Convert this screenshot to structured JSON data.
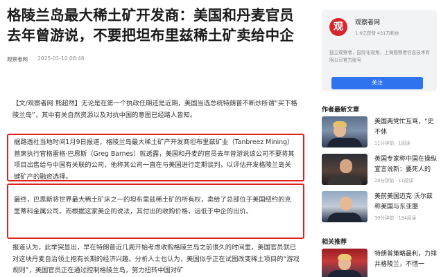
{
  "article": {
    "title": "格陵兰岛最大稀土矿开发商：美国和丹麦官员去年曾游说，不要把坦布里兹稀土矿卖给中企",
    "source": "观察者网",
    "date": "2025-01-10 08:46",
    "p1_tag": "【文/观察者网 熊超然】",
    "p1": "无论是在第一个执政任期还是近期，美国当选总统特朗普不断炒所谓“买下格陵兰岛”，其中有关自然资源以及对抗中国的意图已经路人皆知。",
    "p2": "据路透社当地时间1月9日报道，格陵兰岛最大稀土矿产开发商坦布里兹矿业（Tanbreez Mining）首席执行官格雷格·巴恩斯（Greg Barnes）就透露，美国和丹麦的官员去年曾游说该公司不要将其项目出售给与中国有关联的公司，他称其公司一直在与美国进行定期谈判，以评估开发格陵兰岛关键矿产的融资选择。",
    "p3": "最终，巴恩斯将世界最大稀土矿床之一的坦布里兹稀土矿的所有权，卖给了总部位于美国纽约的克里蒂科金属公司。而根据这家美企的说法，其付出的收购价格，远低于中企的出价。",
    "p4": "报道认为，此举突显出，早在特朗普近几周开始考虑收购格陵兰岛之前很久的时间里，美国官员就已对这块丹麦自治领土抱有长期的经济兴趣。分析人士也认为，美国似乎正在试图改变稀土项目的“游戏规则”，美国官员正在通过控制格陵兰岛，努力扭转中国对矿"
  },
  "account": {
    "logo_char": "观",
    "name": "观察者网",
    "stats": "1.6亿获赞 431万粉丝",
    "desc": "独立观察者，国际化视角，上海观察者信息技术有限公司官方账号",
    "follow_label": "关注"
  },
  "latest": {
    "heading": "作者最新文章",
    "items": [
      {
        "title": "美国两党忙互骂，“史",
        "line2": "不休",
        "meta": "11分钟前 · 1阅读",
        "thumb": "trump-portrait"
      },
      {
        "title": "英国专家称中国在操纵",
        "line2": "宣言说新：要死人的",
        "meta": "28分钟前 · 11阅读",
        "thumb": "man-portrait"
      },
      {
        "title": "美前美国迈克·沃尔兹",
        "line2": "称美国与东亚盟",
        "meta": "30分钟前 · 134阅读",
        "thumb": "speaker-portrait"
      }
    ]
  },
  "related": {
    "heading": "相关推荐",
    "items": [
      {
        "title": "特朗普策略最利，力排",
        "line2": "井格陵兰，不惜一",
        "meta": "",
        "thumb": "trump-flag"
      }
    ]
  },
  "colors": {
    "highlight_border": "#e02020",
    "follow_button": "#2f74ee",
    "logo": "#d9262c"
  }
}
